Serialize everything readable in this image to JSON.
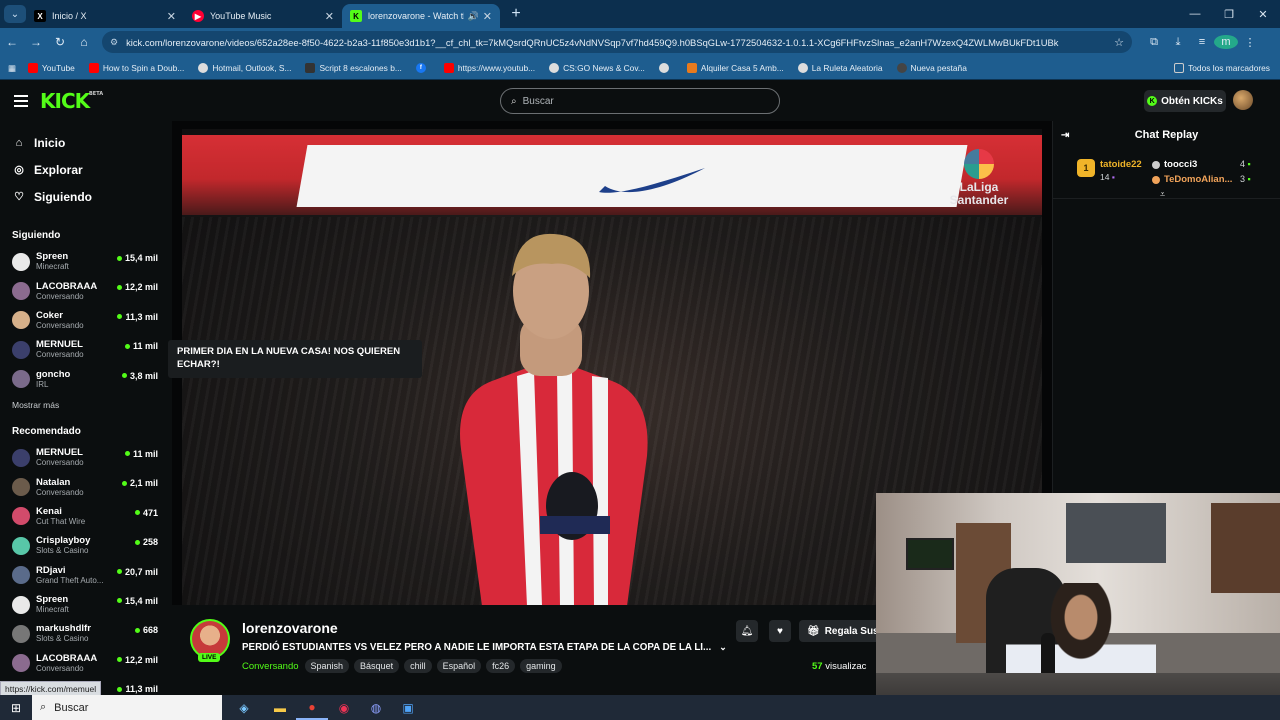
{
  "browser": {
    "tabs": [
      {
        "title": "Inicio / X",
        "icon": "x-logo-icon"
      },
      {
        "title": "YouTube Music",
        "icon": "youtube-music-icon"
      },
      {
        "title": "lorenzovarone - Watch the",
        "icon": "kick-favicon-icon",
        "active": true
      }
    ],
    "url": "kick.com/lorenzovarone/videos/652a28ee-8f50-4622-b2a3-11f850e3d1b1?__cf_chl_tk=7kMQsrdQRnUC5z4vNdNVSqp7vf7hd459Q9.h0BSqGLw-1772504632-1.0.1.1-XCg6FHFtvzSlnas_e2anH7WzexQ4ZWLMwBUkFDt1UBk",
    "profile_initial": "m",
    "bookmarks": [
      {
        "label": "YouTube",
        "color": "#ff0000"
      },
      {
        "label": "How to Spin a Doub...",
        "color": "#ff0000"
      },
      {
        "label": "Hotmail, Outlook, S...",
        "color": "#dddddd"
      },
      {
        "label": "Script 8 escalones b...",
        "color": "#333333"
      },
      {
        "label": "",
        "color": "#1877f2"
      },
      {
        "label": "https://www.youtub...",
        "color": "#ff0000"
      },
      {
        "label": "CS:GO News & Cov...",
        "color": "#dddddd"
      },
      {
        "label": "",
        "color": "#dddddd"
      },
      {
        "label": "Alquiler Casa 5 Amb...",
        "color": "#e87a1d"
      },
      {
        "label": "La Ruleta Aleatoria",
        "color": "#dddddd"
      },
      {
        "label": "Nueva pestaña",
        "color": "#444444"
      }
    ],
    "all_bookmarks": "Todos los marcadores",
    "status_url": "https://kick.com/memuel"
  },
  "kick": {
    "logo": "KICK",
    "beta": "BETA",
    "search_placeholder": "Buscar",
    "get_kicks": "Obtén KICKs"
  },
  "sidebar": {
    "nav": [
      {
        "label": "Inicio",
        "icon": "home-icon",
        "glyph": "⌂"
      },
      {
        "label": "Explorar",
        "icon": "compass-icon",
        "glyph": "◎"
      },
      {
        "label": "Siguiendo",
        "icon": "heart-icon",
        "glyph": "♡"
      }
    ],
    "following_title": "Siguiendo",
    "following": [
      {
        "name": "Spreen",
        "category": "Minecraft",
        "viewers": "15,4 mil",
        "color": "#e9e9e9"
      },
      {
        "name": "LACOBRAAA",
        "category": "Conversando",
        "viewers": "12,2 mil",
        "color": "#8b6b8f"
      },
      {
        "name": "Coker",
        "category": "Conversando",
        "viewers": "11,3 mil",
        "color": "#d6b08a"
      },
      {
        "name": "MERNUEL",
        "category": "Conversando",
        "viewers": "11 mil",
        "color": "#3b3f6b"
      },
      {
        "name": "goncho",
        "category": "IRL",
        "viewers": "3,8 mil",
        "color": "#7a6a8a"
      }
    ],
    "show_more": "Mostrar más",
    "recommended_title": "Recomendado",
    "recommended": [
      {
        "name": "MERNUEL",
        "category": "Conversando",
        "viewers": "11 mil",
        "color": "#3b3f6b"
      },
      {
        "name": "Natalan",
        "category": "Conversando",
        "viewers": "2,1 mil",
        "color": "#6b5b4b"
      },
      {
        "name": "Kenai",
        "category": "Cut That Wire",
        "viewers": "471",
        "color": "#d24b6b"
      },
      {
        "name": "Crisplayboy",
        "category": "Slots & Casino",
        "viewers": "258",
        "color": "#58c7a8"
      },
      {
        "name": "RDjavi",
        "category": "Grand Theft Auto...",
        "viewers": "20,7 mil",
        "color": "#5a6b8a"
      },
      {
        "name": "Spreen",
        "category": "Minecraft",
        "viewers": "15,4 mil",
        "color": "#e9e9e9"
      },
      {
        "name": "markushdlfr",
        "category": "Slots & Casino",
        "viewers": "668",
        "color": "#777777"
      },
      {
        "name": "LACOBRAAA",
        "category": "Conversando",
        "viewers": "12,2 mil",
        "color": "#8b6b8f"
      },
      {
        "name": "",
        "category": "",
        "viewers": "11,3 mil",
        "color": "#d6b08a"
      }
    ],
    "tooltip": "PRIMER DIA EN LA NUEVA CASA! NOS QUIEREN ECHAR?!"
  },
  "video": {
    "overlay_brand": [
      "LaLiga",
      "Santander"
    ]
  },
  "stream": {
    "streamer": "lorenzovarone",
    "live_badge": "LIVE",
    "title": "PERDIÓ ESTUDIANTES VS VELEZ PERO A NADIE LE IMPORTA ESTA ETAPA DE LA COPA DE LA LI...",
    "category": "Conversando",
    "tags": [
      "Spanish",
      "Básquet",
      "chill",
      "Español",
      "fc26",
      "gaming"
    ],
    "gift_label": "Regala Sus",
    "viewers_count": "57",
    "viewers_label": "visualizac"
  },
  "chat": {
    "title": "Chat Replay",
    "top_gifter": {
      "rank": "1",
      "name": "tatoide22",
      "count": "14"
    },
    "gifters": [
      {
        "name": "toocci3",
        "count": "4",
        "color": "#ffffff",
        "mark": "#cccccc"
      },
      {
        "name": "TeDomoAlian...",
        "count": "3",
        "color": "#f0a35a",
        "mark": "#f0a35a"
      }
    ]
  },
  "taskbar": {
    "search_placeholder": "Buscar"
  }
}
